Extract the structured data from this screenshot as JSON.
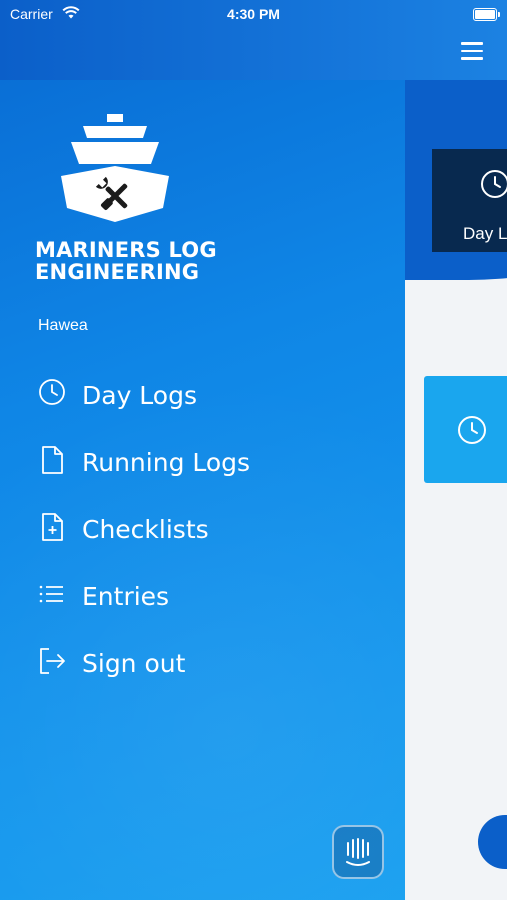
{
  "status_bar": {
    "carrier": "Carrier",
    "time": "4:30 PM"
  },
  "header": {
    "menu_icon": "hamburger-menu-icon"
  },
  "drawer": {
    "brand": {
      "line1": "MARINERS LOG",
      "line2": "ENGINEERING"
    },
    "vessel_name": "Hawea",
    "items": [
      {
        "label": "Day Logs",
        "icon": "clock-icon"
      },
      {
        "label": "Running Logs",
        "icon": "document-icon"
      },
      {
        "label": "Checklists",
        "icon": "document-plus-icon"
      },
      {
        "label": "Entries",
        "icon": "list-icon"
      },
      {
        "label": "Sign out",
        "icon": "sign-out-icon"
      }
    ],
    "chat_icon": "intercom-chat-icon"
  },
  "main": {
    "card_label": "Day L"
  },
  "colors": {
    "drawer_top": "#0a6fd6",
    "drawer_bottom": "#1aa0f0",
    "header": "#0b5fc9",
    "card_dark": "#08294f",
    "tile": "#1aa6ee",
    "background": "#f2f4f7"
  }
}
